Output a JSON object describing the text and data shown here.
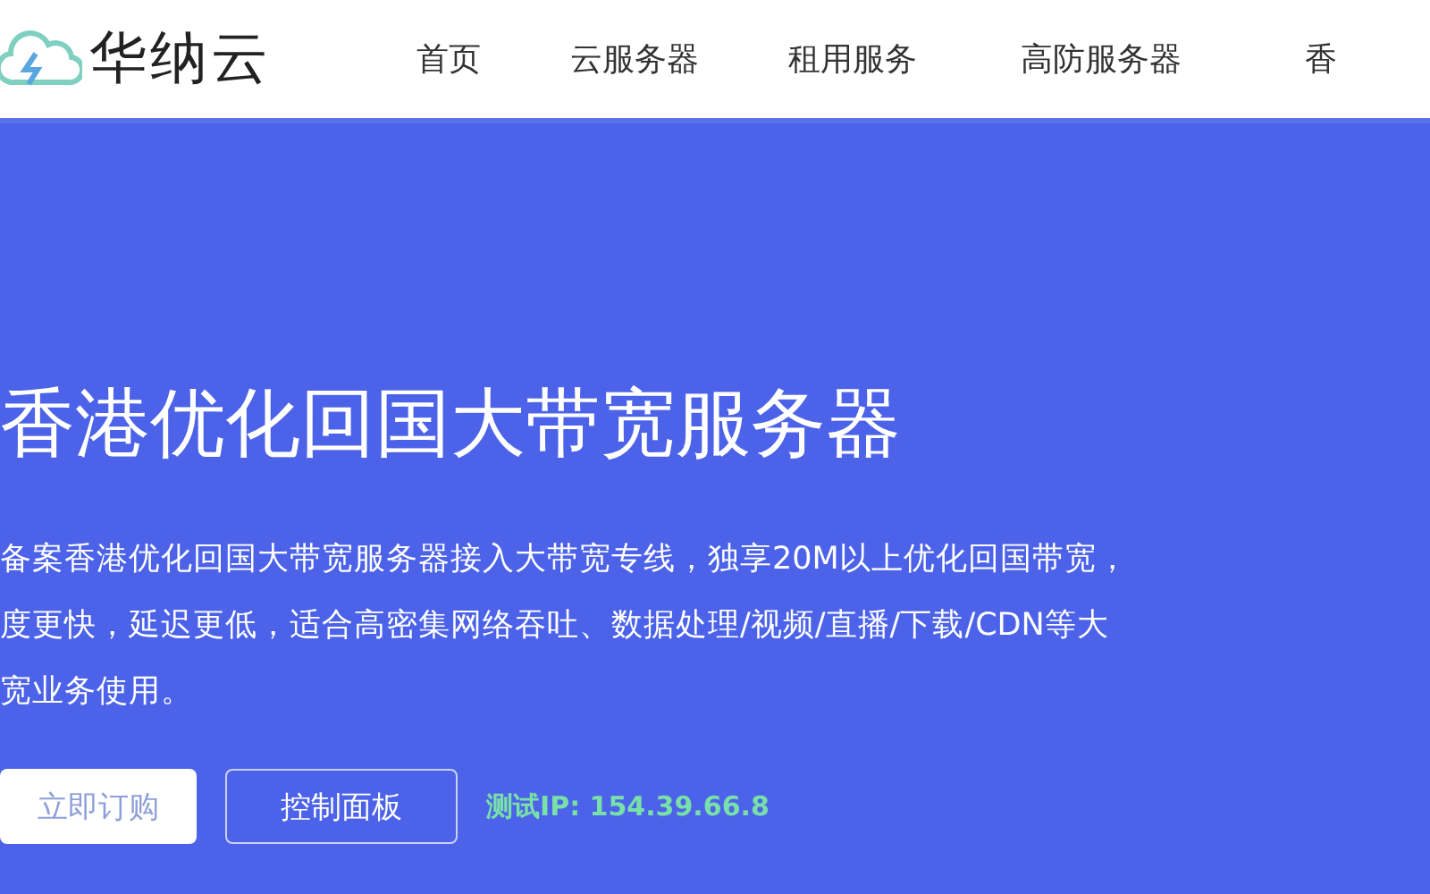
{
  "header": {
    "brand": "华纳云",
    "nav": [
      {
        "label": "首页"
      },
      {
        "label": "云服务器"
      },
      {
        "label": "租用服务"
      },
      {
        "label": "高防服务器"
      },
      {
        "label": "香"
      }
    ]
  },
  "hero": {
    "title": "香港优化回国大带宽服务器",
    "lines": [
      "备案香港优化回国大带宽服务器接入大带宽专线，独享20M以上优化回国带宽，",
      "度更快，延迟更低，适合高密集网络吞吐、数据处理/视频/直播/下载/CDN等大",
      "宽业务使用。"
    ],
    "buttons": [
      {
        "label": "立即订购",
        "kind": "solid"
      },
      {
        "label": "控制面板",
        "kind": "outline"
      }
    ],
    "test_ip": "测试IP: 154.39.66.8"
  }
}
